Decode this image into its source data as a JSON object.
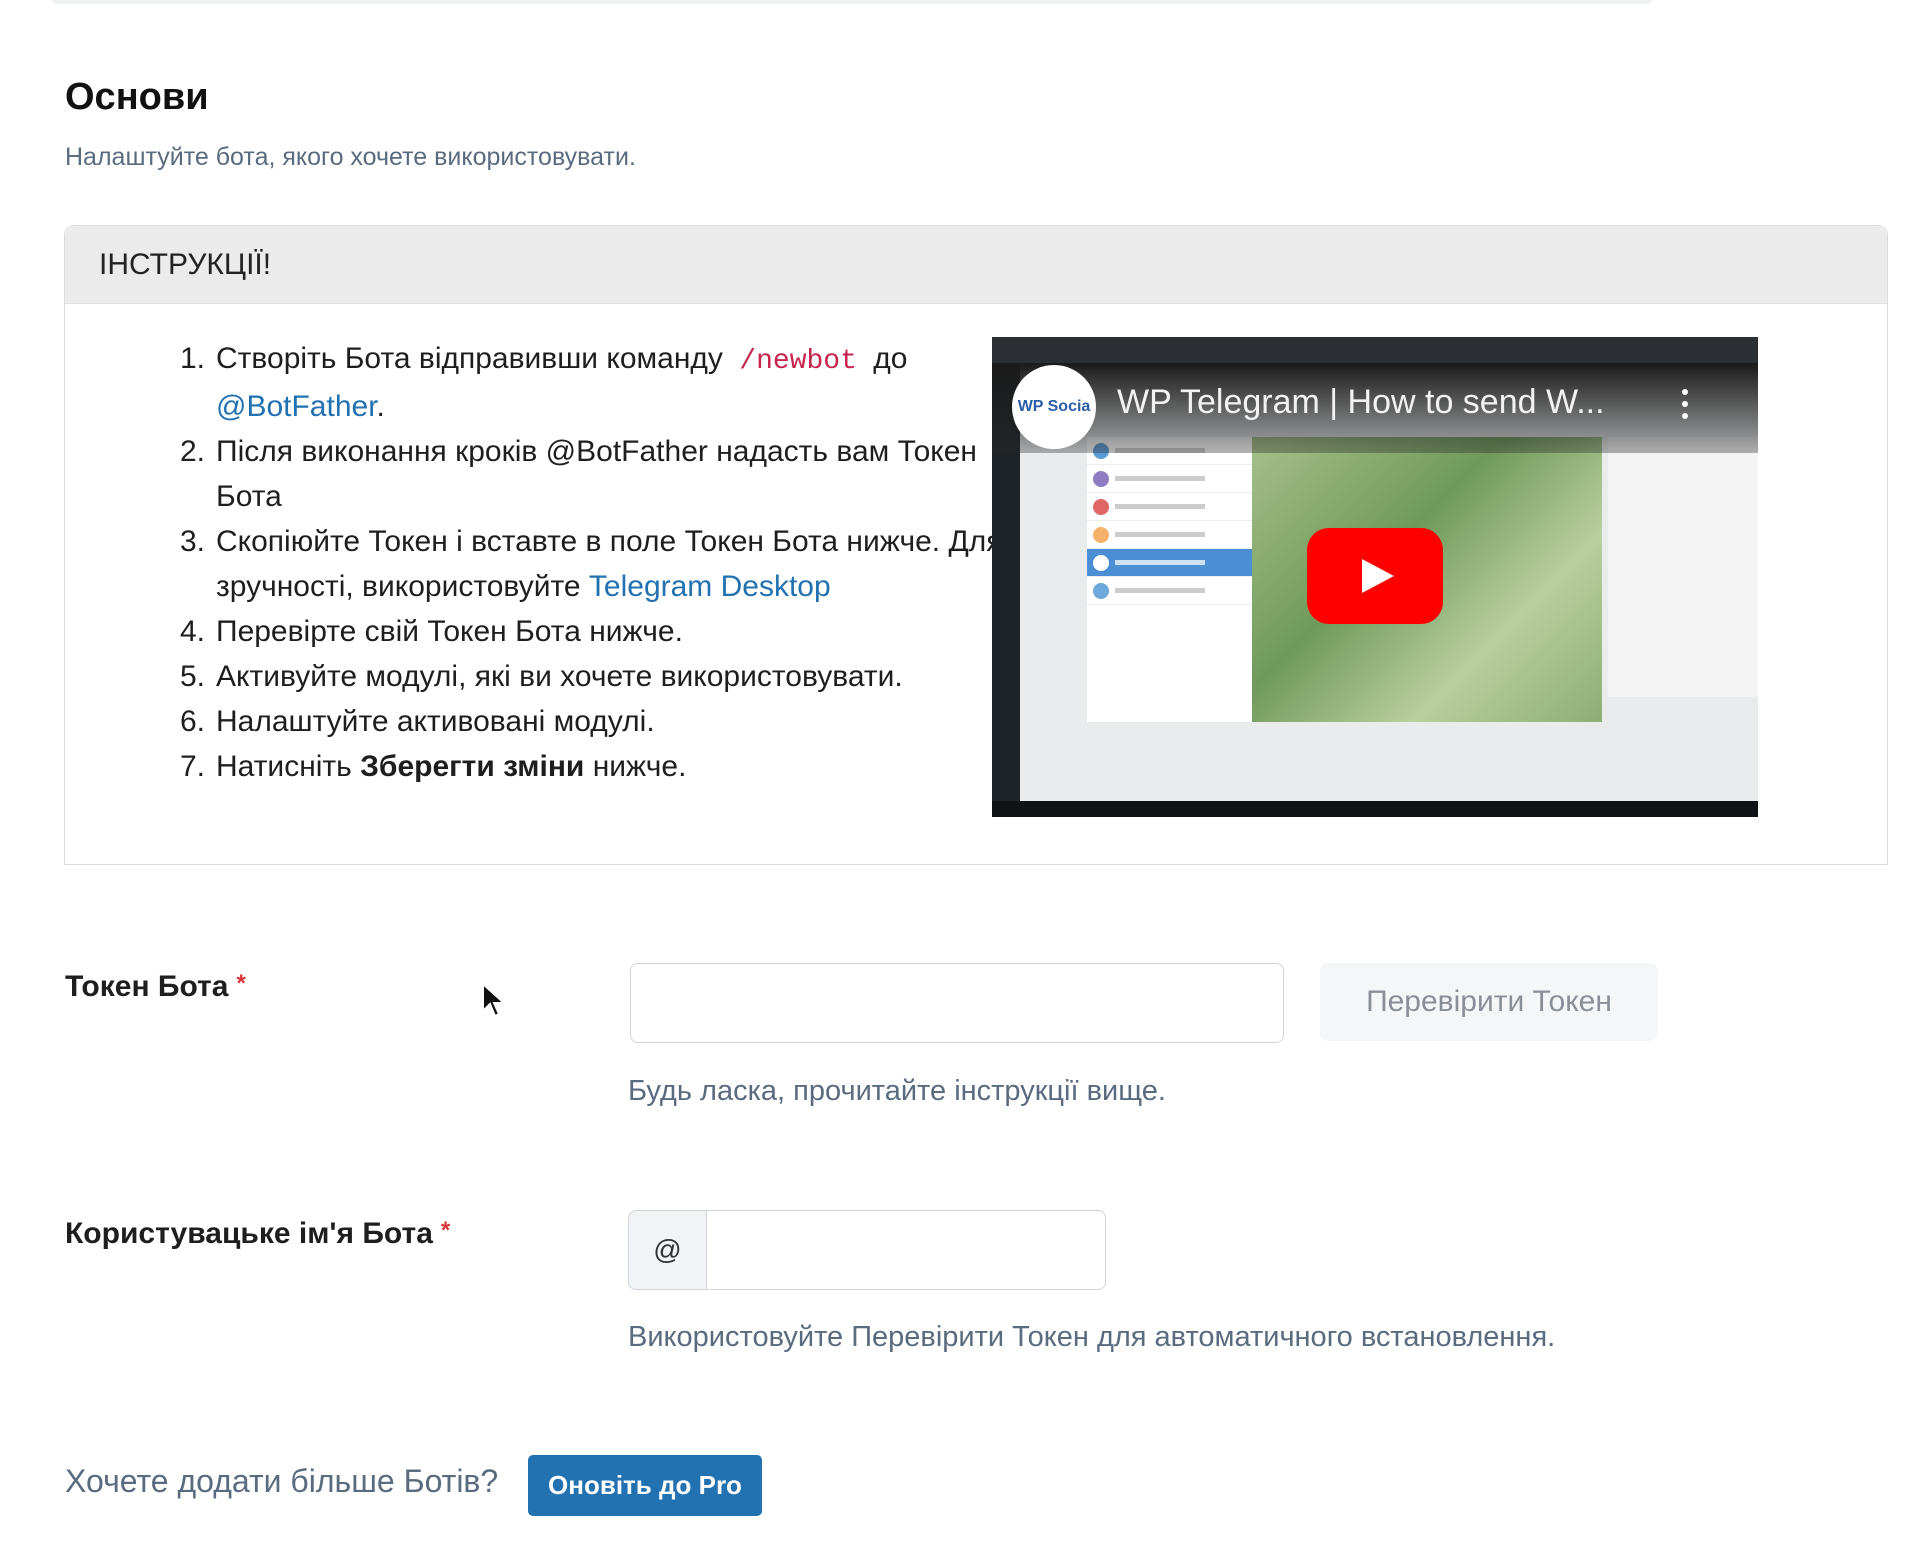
{
  "section": {
    "title": "Основи",
    "description": "Налаштуйте бота, якого хочете використовувати."
  },
  "instructions": {
    "header": "ІНСТРУКЦІЇ!",
    "steps": [
      {
        "num": "1.",
        "text_before": "Створіть Бота відправивши команду",
        "code": "/newbot",
        "text_mid": "до",
        "link": "@BotFather",
        "text_after": "."
      },
      {
        "num": "2.",
        "text": "Після виконання кроків @BotFather надасть вам Токен Бота"
      },
      {
        "num": "3.",
        "text_before": "Скопіюйте Токен і вставте в поле Токен Бота нижче. Для зручності, використовуйте",
        "link": "Telegram Desktop"
      },
      {
        "num": "4.",
        "text": "Перевірте свій Токен Бота нижче."
      },
      {
        "num": "5.",
        "text": "Активуйте модулі, які ви хочете використовувати."
      },
      {
        "num": "6.",
        "text": "Налаштуйте активовані модулі."
      },
      {
        "num": "7.",
        "text_before": "Натисніть",
        "bold": "Зберегти зміни",
        "text_after": "нижче."
      }
    ],
    "video": {
      "title": "WP Telegram | How to send W...",
      "channel_logo": "WP Socia"
    }
  },
  "bot_token": {
    "label": "Токен Бота",
    "required_mark": "*",
    "value": "",
    "check_button": "Перевірити Токен",
    "help": "Будь ласка, прочитайте інструкції вище."
  },
  "bot_username": {
    "label": "Користувацьке ім'я Бота",
    "required_mark": "*",
    "prefix": "@",
    "value": "",
    "help": "Використовуйте Перевірити Токен для автоматичного встановлення."
  },
  "more_bots": {
    "text": "Хочете додати більше Ботів?",
    "button": "Оновіть до Pro"
  },
  "colors": {
    "link": "#2271b1",
    "required": "#d63638",
    "code": "#c7254e",
    "youtube_red": "#ff0000"
  }
}
